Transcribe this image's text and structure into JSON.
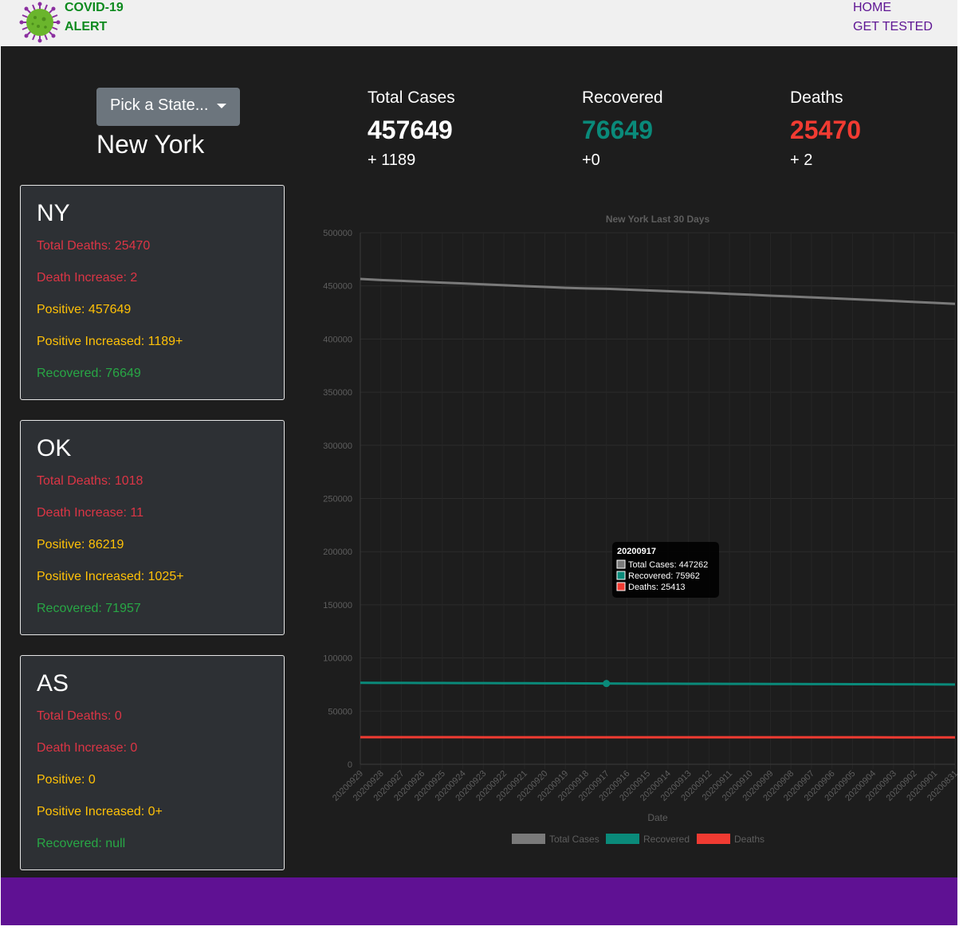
{
  "header": {
    "brand_line1": "COVID-19",
    "brand_line2": "ALERT",
    "logo_icon": "virus-icon",
    "nav": [
      "HOME",
      "GET TESTED"
    ]
  },
  "picker": {
    "button_label": "Pick a State...",
    "selected_state": "New York"
  },
  "summary": {
    "total_cases": {
      "label": "Total Cases",
      "value": "457649",
      "increase": "+ 1189"
    },
    "recovered": {
      "label": "Recovered",
      "value": "76649",
      "increase": "+0"
    },
    "deaths": {
      "label": "Deaths",
      "value": "25470",
      "increase": "+ 2"
    }
  },
  "cards": [
    {
      "code": "NY",
      "total_deaths": "Total Deaths: 25470",
      "death_increase": "Death Increase: 2",
      "positive": "Positive: 457649",
      "positive_increased": "Positive Increased: 1189+",
      "recovered": "Recovered: 76649"
    },
    {
      "code": "OK",
      "total_deaths": "Total Deaths: 1018",
      "death_increase": "Death Increase: 11",
      "positive": "Positive: 86219",
      "positive_increased": "Positive Increased: 1025+",
      "recovered": "Recovered: 71957"
    },
    {
      "code": "AS",
      "total_deaths": "Total Deaths: 0",
      "death_increase": "Death Increase: 0",
      "positive": "Positive: 0",
      "positive_increased": "Positive Increased: 0+",
      "recovered": "Recovered: null"
    }
  ],
  "colors": {
    "total_cases": "#7a7a7a",
    "recovered": "#0a8a7a",
    "deaths": "#f13b32",
    "purple": "#5f1193"
  },
  "chart_data": {
    "type": "line",
    "title": "New York Last 30 Days",
    "xlabel": "Date",
    "ylabel": "",
    "ylim": [
      0,
      500000
    ],
    "yticks": [
      0,
      50000,
      100000,
      150000,
      200000,
      250000,
      300000,
      350000,
      400000,
      450000,
      500000
    ],
    "legend_position": "bottom",
    "grid": true,
    "categories": [
      "20200929",
      "20200928",
      "20200927",
      "20200926",
      "20200925",
      "20200924",
      "20200923",
      "20200922",
      "20200921",
      "20200920",
      "20200919",
      "20200918",
      "20200917",
      "20200916",
      "20200915",
      "20200914",
      "20200913",
      "20200912",
      "20200911",
      "20200910",
      "20200909",
      "20200908",
      "20200907",
      "20200906",
      "20200905",
      "20200904",
      "20200903",
      "20200902",
      "20200901",
      "20200831"
    ],
    "series": [
      {
        "name": "Total Cases",
        "values": [
          456500,
          455500,
          454700,
          453900,
          453100,
          452300,
          451500,
          450600,
          449800,
          449000,
          448200,
          447600,
          447262,
          446500,
          445700,
          445000,
          444200,
          443400,
          442500,
          441700,
          440800,
          440000,
          439200,
          438300,
          437500,
          436700,
          435800,
          434900,
          434000,
          433100
        ]
      },
      {
        "name": "Recovered",
        "values": [
          76649,
          76600,
          76550,
          76500,
          76450,
          76400,
          76350,
          76300,
          76250,
          76200,
          76150,
          76050,
          75962,
          75900,
          75850,
          75800,
          75750,
          75700,
          75650,
          75600,
          75550,
          75500,
          75450,
          75400,
          75350,
          75300,
          75250,
          75200,
          75150,
          75100
        ]
      },
      {
        "name": "Deaths",
        "values": [
          25470,
          25465,
          25460,
          25455,
          25450,
          25445,
          25440,
          25435,
          25430,
          25425,
          25420,
          25418,
          25413,
          25408,
          25403,
          25398,
          25393,
          25388,
          25383,
          25378,
          25373,
          25368,
          25363,
          25358,
          25353,
          25348,
          25343,
          25338,
          25333,
          25328
        ]
      }
    ],
    "tooltip": {
      "date": "20200917",
      "lines": [
        "Total Cases: 447262",
        "Recovered: 75962",
        "Deaths: 25413"
      ]
    }
  }
}
